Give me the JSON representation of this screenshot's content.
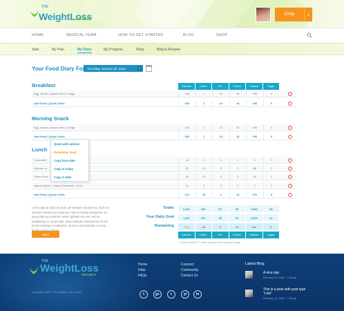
{
  "header": {
    "logo_the": "THE",
    "logo_main": "WeightLoss",
    "logo_project": "PROJECT",
    "user_name": "Emily"
  },
  "nav": [
    "HOME",
    "MEDICAL TEAM",
    "HOW TO GET STARTED",
    "BLOG",
    "SHOP"
  ],
  "subnav": [
    "Start",
    "My Plan",
    "My Diary",
    "My Progress",
    "Shop",
    "Blog & Recipes"
  ],
  "subnav_active": "My Diary",
  "diary": {
    "title": "Your Food Diary For:",
    "date": "Thursday, January 28, 2016"
  },
  "columns": [
    "Calories",
    "Carbs",
    "Fat",
    "Protein",
    "Sodium",
    "Sugar"
  ],
  "breakfast": {
    "title": "Breakfast",
    "foods": [
      {
        "name": "Egg, whole, cooked, fried, 2 large",
        "values": [
          "160",
          "1",
          "14",
          "16",
          "190",
          "0"
        ]
      }
    ],
    "total": {
      "label": "Add Food | Quick Tools",
      "values": [
        "160",
        "1",
        "14",
        "16",
        "190",
        "0"
      ]
    }
  },
  "snack": {
    "title": "Morning Snack",
    "foods": [
      {
        "name": "Egg, whole, cooked, fried, 2 large",
        "values": [
          "160",
          "1",
          "14",
          "16",
          "190",
          "0"
        ]
      }
    ],
    "total": {
      "label": "Add Food | Quick Tools",
      "values": [
        "160",
        "1",
        "14",
        "16",
        "190",
        "0"
      ]
    }
  },
  "lunch": {
    "title": "Lunch",
    "foods": [
      {
        "name": "Cucumber",
        "values": [
          "16",
          "4",
          "0",
          "1",
          "2",
          "2"
        ]
      },
      {
        "name": "Carrots, ra",
        "values": [
          "52",
          "12",
          "0",
          "1",
          "88",
          "2"
        ]
      },
      {
        "name": "Green Onio",
        "values": [
          "32",
          "13",
          "0",
          "2",
          "16",
          "2"
        ]
      },
      {
        "name": "Nature Sweet - Cherry Tomatoes, 3.5 oz",
        "values": [
          "14",
          "3",
          "0",
          "1",
          "2",
          "2"
        ]
      }
    ],
    "total": {
      "label": "Add Food | Quick Tools",
      "values": [
        "211",
        "48",
        "1",
        "12",
        "102",
        "8"
      ]
    }
  },
  "menu": [
    "Quick add calories",
    "Remember meal",
    "Copy from date",
    "Copy to today",
    "Copy to date"
  ],
  "lorem": "Lorem ipsum dolor sit amet, at omnium noluisse vix. Eam eu sanctus maiorum accusamus, has ne facete scriptorem, ex sea probo accusamus, antiot luptatum an eos, sed et sadipscing cu vix percipit, dicam aliquip mnesarchum id est, ea his recteque mediocrem. Ut mea vel mandetur, ex sum fatidit nominit nolisse.",
  "save_label": "Save",
  "totals": {
    "totals_label": "Totals",
    "totals": [
      "1,231",
      "100",
      "54",
      "89",
      "1,954",
      "69"
    ],
    "goal_label": "Your Daily Goal",
    "goal": [
      "1,111",
      "102",
      "45",
      "51",
      "2,300",
      "41"
    ],
    "remaining_label": "Remaining",
    "remaining": [
      "-121",
      "-49",
      "-9",
      "12",
      "341",
      "6"
    ]
  },
  "note": "* You've earned 17 extra calories from exercise today",
  "footer": {
    "col1": [
      "Home",
      "Help",
      "FAQs"
    ],
    "col2": [
      "Connect",
      "Community",
      "Contact Us"
    ],
    "copyright": "Copyright 2016 © The Weight Loss Project",
    "social": [
      "f",
      "g+",
      "t",
      "yt",
      "in"
    ],
    "blog_title": "Latest Blog",
    "posts": [
      {
        "title": "A nice day",
        "date": "February 12, 2016 · 7:28 pm"
      },
      {
        "title": "This is a post with post type \"Link\"",
        "date": "February 12, 2016 · 7:28 pm"
      }
    ]
  },
  "colors": {
    "accent": "#1e8fbd",
    "orange": "#f7941d",
    "teal": "#19a7c6",
    "footer": "#0d3f78"
  }
}
